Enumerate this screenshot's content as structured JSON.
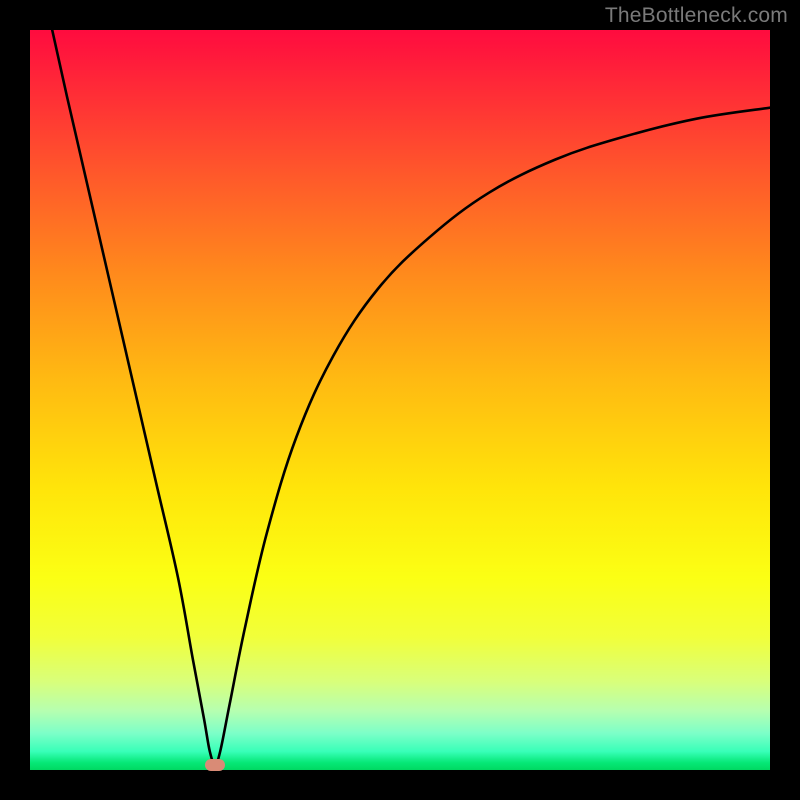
{
  "watermark": "TheBottleneck.com",
  "chart_data": {
    "type": "line",
    "title": "",
    "xlabel": "",
    "ylabel": "",
    "xlim": [
      0,
      100
    ],
    "ylim": [
      0,
      100
    ],
    "grid": false,
    "legend": false,
    "background": "rainbow-vertical",
    "series": [
      {
        "name": "bottleneck-curve",
        "x": [
          3,
          5,
          8,
          11,
          14,
          17,
          20,
          22,
          23.5,
          24.3,
          25,
          25.7,
          27,
          29,
          32,
          36,
          41,
          47,
          54,
          62,
          71,
          80,
          90,
          100
        ],
        "y": [
          100,
          91,
          78,
          65,
          52,
          39,
          26,
          15,
          7,
          2.5,
          0.8,
          2.5,
          9,
          19,
          32,
          45,
          56,
          65,
          72,
          78,
          82.5,
          85.5,
          88,
          89.5
        ]
      }
    ],
    "marker": {
      "x": 25,
      "y": 0.7,
      "color": "#d98b76"
    },
    "colors": {
      "curve": "#000000",
      "gradient_top": "#ff0b3f",
      "gradient_bottom": "#00d861"
    }
  }
}
